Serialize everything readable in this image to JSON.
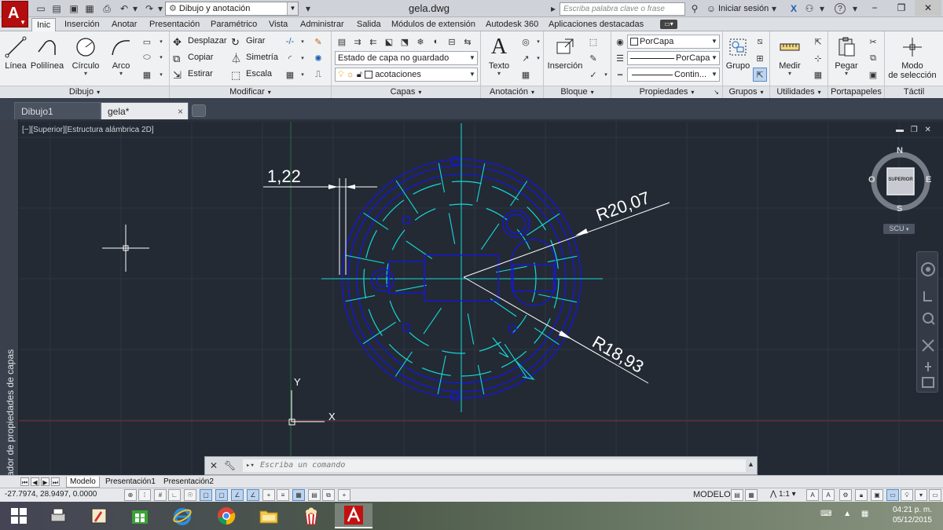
{
  "titlebar": {
    "workspace": "Dibujo y anotación",
    "doc_title": "gela.dwg",
    "search_placeholder": "Escriba palabra clave o frase",
    "signin": "Iniciar sesión",
    "help": "?"
  },
  "ribbon_tabs": [
    {
      "label": "Inic",
      "active": true
    },
    {
      "label": "Inserción"
    },
    {
      "label": "Anotar"
    },
    {
      "label": "Presentación"
    },
    {
      "label": "Paramétrico"
    },
    {
      "label": "Vista"
    },
    {
      "label": "Administrar"
    },
    {
      "label": "Salida"
    },
    {
      "label": "Módulos de extensión"
    },
    {
      "label": "Autodesk 360"
    },
    {
      "label": "Aplicaciones destacadas"
    }
  ],
  "ribbon": {
    "dibujo": {
      "title": "Dibujo",
      "linea": "Línea",
      "polilinea": "Polilínea",
      "circulo": "Círculo",
      "arco": "Arco"
    },
    "modificar": {
      "title": "Modificar",
      "desplazar": "Desplazar",
      "girar": "Girar",
      "copiar": "Copiar",
      "simetria": "Simetría",
      "estirar": "Estirar",
      "escala": "Escala"
    },
    "capas": {
      "title": "Capas",
      "estado": "Estado de capa no guardado",
      "layer": "acotaciones"
    },
    "anotacion": {
      "title": "Anotación",
      "texto": "Texto"
    },
    "bloque": {
      "title": "Bloque",
      "insercion": "Inserción"
    },
    "propiedades": {
      "title": "Propiedades",
      "color": "PorCapa",
      "linetype": "PorCapa",
      "lineweight": "Contin..."
    },
    "grupos": {
      "title": "Grupos",
      "grupo": "Grupo"
    },
    "utilidades": {
      "title": "Utilidades",
      "medir": "Medir"
    },
    "portapapeles": {
      "title": "Portapapeles",
      "pegar": "Pegar"
    },
    "tactil": {
      "title": "Táctil",
      "modo_line1": "Modo",
      "modo_line2": "de selección"
    }
  },
  "file_tabs": [
    {
      "label": "Dibujo1"
    },
    {
      "label": "gela*",
      "active": true
    }
  ],
  "viewport": {
    "label": "[−][Superior][Estructura alámbrica 2D]",
    "compass_n": "N",
    "compass_s": "S",
    "compass_e": "E",
    "compass_o": "O",
    "cube_face": "SUPERIOR",
    "ucs": "SCU"
  },
  "drawing": {
    "dim_small": "1,22",
    "dim_r1": "R20,07",
    "dim_r2": "R18,93",
    "ucs_y": "Y",
    "ucs_x": "X",
    "colors": {
      "background": "#232a34",
      "blue": "#1515e6",
      "cyan": "#17d8d8",
      "white": "#ffffff",
      "grid": "#2e3642"
    }
  },
  "command": {
    "placeholder": "Escriba un comando"
  },
  "layout_tabs": [
    {
      "label": "Modelo",
      "active": true
    },
    {
      "label": "Presentación1"
    },
    {
      "label": "Presentación2"
    }
  ],
  "statusbar": {
    "coords": "-27.7974, 28.9497, 0.0000",
    "modelo": "MODELO",
    "scale": "1:1"
  },
  "taskbar": {
    "time": "04:21 p. m.",
    "date": "05/12/2015"
  }
}
